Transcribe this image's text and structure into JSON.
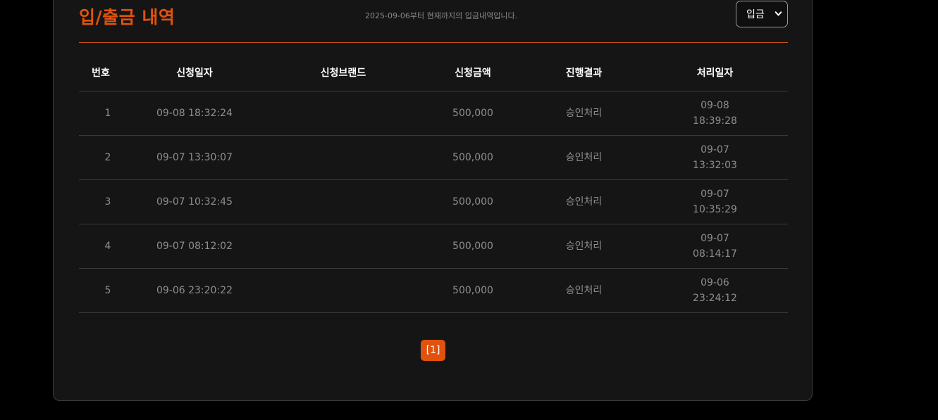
{
  "header": {
    "title": "입/출금 내역",
    "subtitle": "2025-09-06부터 현재까지의 입금내역입니다.",
    "type_select": {
      "selected": "입금"
    }
  },
  "table": {
    "columns": [
      "번호",
      "신청일자",
      "신청브랜드",
      "신청금액",
      "진행결과",
      "처리일자"
    ],
    "rows": [
      {
        "no": "1",
        "request_date": "09-08 18:32:24",
        "brand": "",
        "amount": "500,000",
        "status": "승인처리",
        "processed_date": "09-08",
        "processed_time": "18:39:28"
      },
      {
        "no": "2",
        "request_date": "09-07 13:30:07",
        "brand": "",
        "amount": "500,000",
        "status": "승인처리",
        "processed_date": "09-07",
        "processed_time": "13:32:03"
      },
      {
        "no": "3",
        "request_date": "09-07 10:32:45",
        "brand": "",
        "amount": "500,000",
        "status": "승인처리",
        "processed_date": "09-07",
        "processed_time": "10:35:29"
      },
      {
        "no": "4",
        "request_date": "09-07 08:12:02",
        "brand": "",
        "amount": "500,000",
        "status": "승인처리",
        "processed_date": "09-07",
        "processed_time": "08:14:17"
      },
      {
        "no": "5",
        "request_date": "09-06 23:20:22",
        "brand": "",
        "amount": "500,000",
        "status": "승인처리",
        "processed_date": "09-06",
        "processed_time": "23:24:12"
      }
    ]
  },
  "pagination": {
    "current": "[1]"
  },
  "colors": {
    "accent": "#e0520d",
    "background": "#000000",
    "panel": "#151515",
    "muted_text": "#8e8e8e"
  },
  "icons": {
    "select_arrow": "chevron-down-icon"
  }
}
